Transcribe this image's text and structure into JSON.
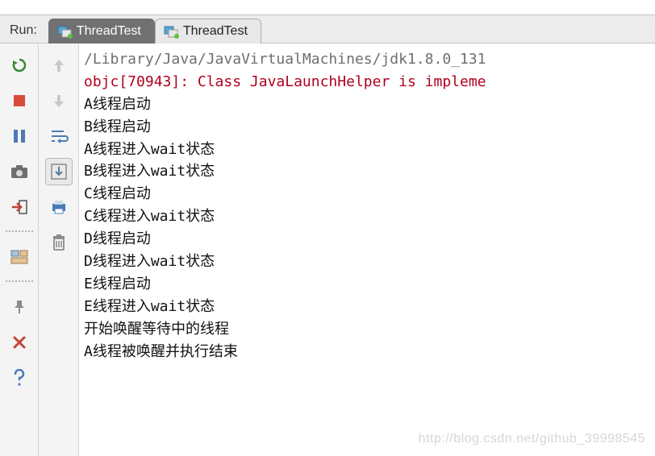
{
  "run_label": "Run:",
  "tabs": [
    {
      "label": "ThreadTest",
      "active": true
    },
    {
      "label": "ThreadTest",
      "active": false
    }
  ],
  "toolbar_a": {
    "rerun": "rerun-icon",
    "stop": "stop-icon",
    "pause": "pause-icon",
    "dump": "camera-icon",
    "exit": "exit-icon",
    "layout": "layout-icon",
    "pin": "pin-icon",
    "close": "close-icon",
    "help": "help-icon"
  },
  "toolbar_b": {
    "up": "arrow-up-icon",
    "down": "arrow-down-icon",
    "wrap": "soft-wrap-icon",
    "scroll_end": "scroll-to-end-icon",
    "print": "print-icon",
    "clear": "trash-icon"
  },
  "console": {
    "lines": [
      {
        "cls": "info",
        "text": "/Library/Java/JavaVirtualMachines/jdk1.8.0_131"
      },
      {
        "cls": "err",
        "text": "objc[70943]: Class JavaLaunchHelper is impleme"
      },
      {
        "cls": "line",
        "text": "A线程启动"
      },
      {
        "cls": "line",
        "text": "B线程启动"
      },
      {
        "cls": "line",
        "text": "A线程进入wait状态"
      },
      {
        "cls": "line",
        "text": "B线程进入wait状态"
      },
      {
        "cls": "line",
        "text": "C线程启动"
      },
      {
        "cls": "line",
        "text": "C线程进入wait状态"
      },
      {
        "cls": "line",
        "text": "D线程启动"
      },
      {
        "cls": "line",
        "text": "D线程进入wait状态"
      },
      {
        "cls": "line",
        "text": "E线程启动"
      },
      {
        "cls": "line",
        "text": "E线程进入wait状态"
      },
      {
        "cls": "line",
        "text": "开始唤醒等待中的线程"
      },
      {
        "cls": "line",
        "text": "A线程被唤醒并执行结束"
      }
    ]
  },
  "watermark": "http://blog.csdn.net/github_39998545"
}
